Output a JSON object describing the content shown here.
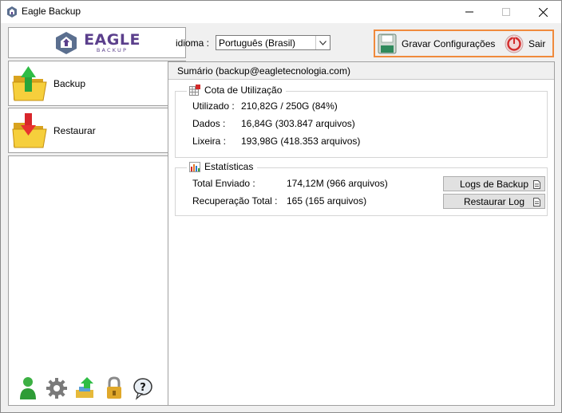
{
  "window": {
    "title": "Eagle Backup"
  },
  "logo": {
    "main": "EAGLE",
    "sub": "BACKUP"
  },
  "nav": {
    "backup_label": "Backup",
    "restore_label": "Restaurar"
  },
  "toolbar": {
    "language_label": "idioma :",
    "language_value": "Português (Brasil)",
    "save_label": "Gravar Configurações",
    "exit_label": "Sair"
  },
  "summary": {
    "header": "Sumário (backup@eagletecnologia.com)",
    "quota": {
      "title": "Cota de Utilização",
      "used_label": "Utilizado :",
      "used_value": "210,82G / 250G (84%)",
      "data_label": "Dados :",
      "data_value": "16,84G  (303.847 arquivos)",
      "trash_label": "Lixeira :",
      "trash_value": "193,98G  (418.353 arquivos)"
    },
    "stats": {
      "title": "Estatísticas",
      "sent_label": "Total Enviado :",
      "sent_value": "174,12M  (966 arquivos)",
      "recovery_label": "Recuperação Total :",
      "recovery_value": "165  (165 arquivos)",
      "logs_button": "Logs de Backup",
      "restore_log_button": "Restaurar Log"
    }
  },
  "bottom_icons": [
    "user-icon",
    "gear-icon",
    "transfer-icon",
    "lock-icon",
    "help-icon"
  ],
  "colors": {
    "highlight": "#f08a3c",
    "brand": "#5b3f8c"
  }
}
